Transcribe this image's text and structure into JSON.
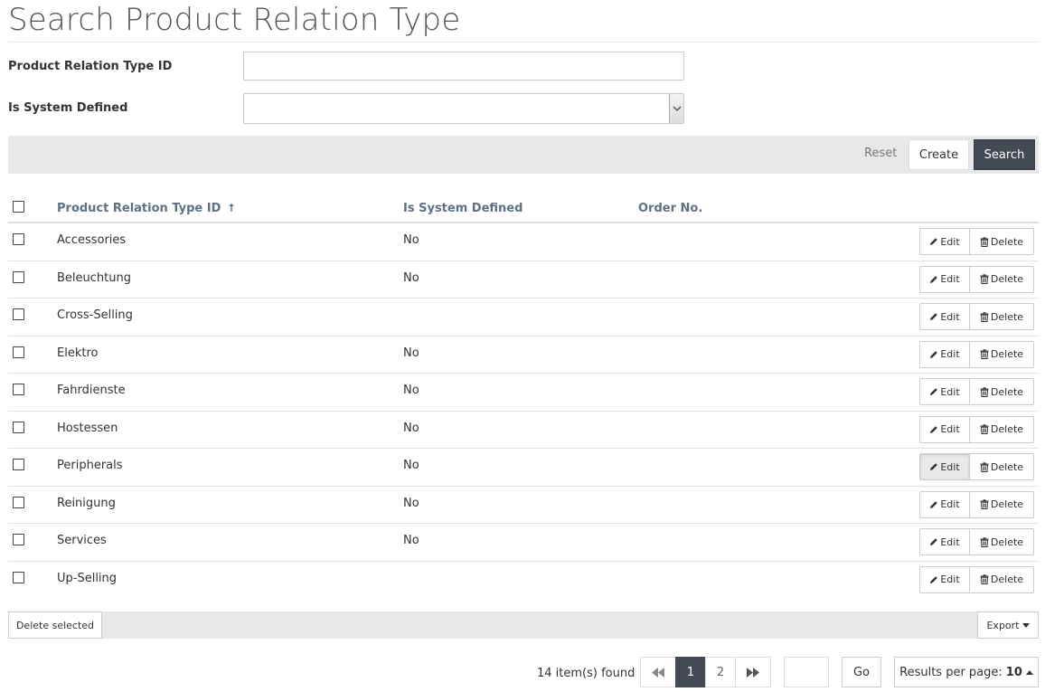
{
  "page": {
    "title": "Search Product Relation Type"
  },
  "form": {
    "fields": [
      {
        "label": "Product Relation Type ID",
        "value": ""
      },
      {
        "label": "Is System Defined",
        "value": ""
      }
    ]
  },
  "toolbar": {
    "reset_label": "Reset",
    "create_label": "Create",
    "search_label": "Search"
  },
  "table": {
    "columns": [
      "Product Relation Type ID",
      "Is System Defined",
      "Order No."
    ],
    "sort_indicator": "↑",
    "rows": [
      {
        "id": "Accessories",
        "system": "No",
        "order": ""
      },
      {
        "id": "Beleuchtung",
        "system": "No",
        "order": ""
      },
      {
        "id": "Cross-Selling",
        "system": "",
        "order": ""
      },
      {
        "id": "Elektro",
        "system": "No",
        "order": ""
      },
      {
        "id": "Fahrdienste",
        "system": "No",
        "order": ""
      },
      {
        "id": "Hostessen",
        "system": "No",
        "order": ""
      },
      {
        "id": "Peripherals",
        "system": "No",
        "order": ""
      },
      {
        "id": "Reinigung",
        "system": "No",
        "order": ""
      },
      {
        "id": "Services",
        "system": "No",
        "order": ""
      },
      {
        "id": "Up-Selling",
        "system": "",
        "order": ""
      }
    ],
    "edit_label": "Edit",
    "delete_label": "Delete"
  },
  "footer": {
    "delete_selected_label": "Delete selected",
    "export_label": "Export"
  },
  "pagination": {
    "items_found": "14 item(s) found",
    "pages": [
      "1",
      "2"
    ],
    "current_page": "1",
    "go_label": "Go",
    "results_label": "Results per page:",
    "results_value": "10"
  },
  "colors": {
    "accent_dark": "#434a54",
    "header_text": "#5f7082",
    "toolbar_bg": "#e8e8e8"
  },
  "icons": [
    "sort-up-icon",
    "pencil-icon",
    "trash-icon",
    "first-page-icon",
    "last-page-icon",
    "caret-down-icon",
    "caret-up-icon",
    "chevron-down-icon"
  ]
}
